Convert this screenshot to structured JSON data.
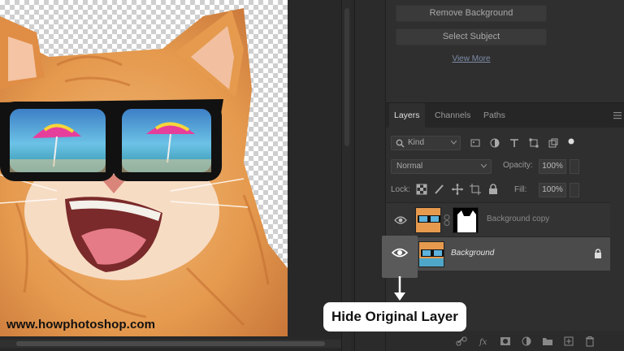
{
  "properties": {
    "remove_background": "Remove Background",
    "select_subject": "Select Subject",
    "view_more": "View More"
  },
  "layers_panel": {
    "tabs": [
      {
        "label": "Layers",
        "active": true
      },
      {
        "label": "Channels",
        "active": false
      },
      {
        "label": "Paths",
        "active": false
      }
    ],
    "filter_kind": "Kind",
    "blend_mode": "Normal",
    "opacity_label": "Opacity:",
    "opacity_value": "100%",
    "lock_label": "Lock:",
    "fill_label": "Fill:",
    "fill_value": "100%",
    "layers": [
      {
        "name": "Background copy",
        "visible": true,
        "selected": false,
        "has_mask": true
      },
      {
        "name": "Background",
        "visible": true,
        "selected": true,
        "locked": true
      }
    ]
  },
  "canvas": {
    "watermark": "www.howphotoshop.com"
  },
  "annotation": {
    "callout": "Hide Original Layer"
  },
  "colors": {
    "panel_bg": "#2f2f2f",
    "selected_layer": "#4b4b4b",
    "callout_bg": "#ffffff"
  }
}
